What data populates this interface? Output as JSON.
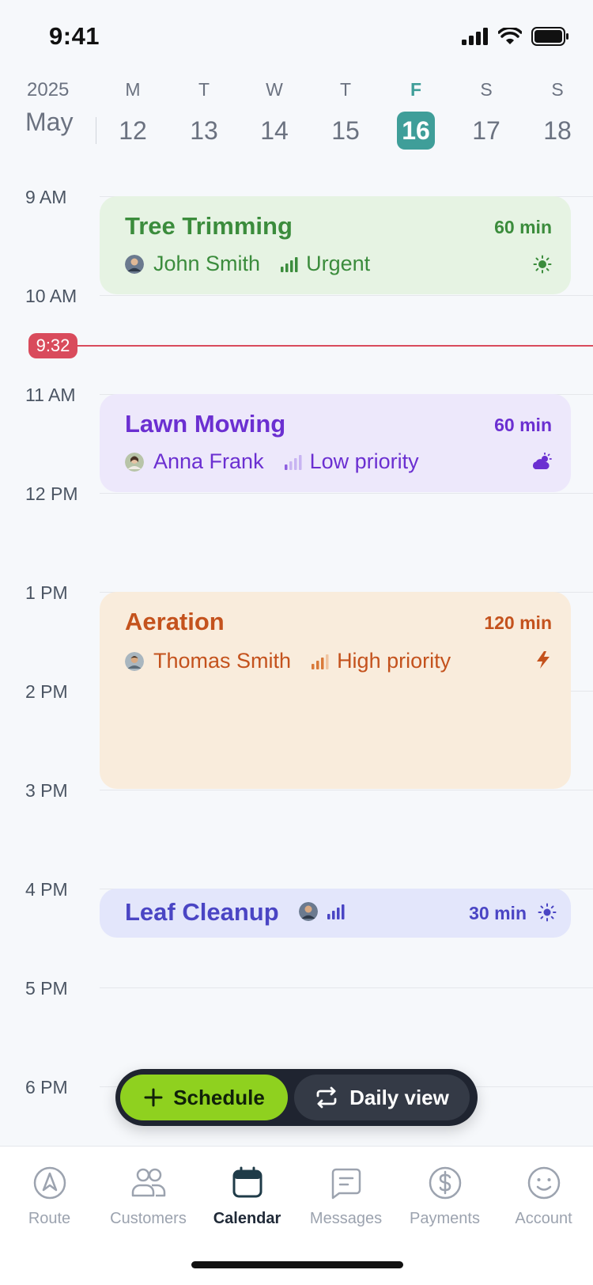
{
  "status": {
    "time": "9:41"
  },
  "week": {
    "year": "2025",
    "month": "May",
    "days": [
      {
        "letter": "M",
        "num": "12"
      },
      {
        "letter": "T",
        "num": "13"
      },
      {
        "letter": "W",
        "num": "14"
      },
      {
        "letter": "T",
        "num": "15"
      },
      {
        "letter": "F",
        "num": "16"
      },
      {
        "letter": "S",
        "num": "17"
      },
      {
        "letter": "S",
        "num": "18"
      }
    ],
    "selected_num": "16"
  },
  "timeline": {
    "hours": [
      "9 AM",
      "10 AM",
      "11 AM",
      "12 PM",
      "1 PM",
      "2 PM",
      "3 PM",
      "4 PM",
      "5 PM",
      "6 PM"
    ],
    "now_label": "9:32"
  },
  "events": [
    {
      "title": "Tree Trimming",
      "duration": "60 min",
      "person": "John Smith",
      "priority": "Urgent",
      "weather_icon": "sun-icon",
      "color": "#3b8c3c"
    },
    {
      "title": "Lawn Mowing",
      "duration": "60 min",
      "person": "Anna Frank",
      "priority": "Low priority",
      "weather_icon": "cloud-sun-icon",
      "color": "#6b2fd1"
    },
    {
      "title": "Aeration",
      "duration": "120 min",
      "person": "Thomas Smith",
      "priority": "High priority",
      "weather_icon": "lightning-icon",
      "color": "#c4521d"
    },
    {
      "title": "Leaf Cleanup",
      "duration": "30 min",
      "weather_icon": "sun-icon",
      "color": "#4a45c4"
    }
  ],
  "actions": {
    "schedule_label": "Schedule",
    "daily_view_label": "Daily view"
  },
  "tabs": [
    {
      "label": "Route",
      "icon": "route-icon"
    },
    {
      "label": "Customers",
      "icon": "customers-icon"
    },
    {
      "label": "Calendar",
      "icon": "calendar-icon"
    },
    {
      "label": "Messages",
      "icon": "messages-icon"
    },
    {
      "label": "Payments",
      "icon": "payments-icon"
    },
    {
      "label": "Account",
      "icon": "account-icon"
    }
  ],
  "active_tab": "Calendar",
  "colors": {
    "accent": "#3f9e99",
    "now": "#d94b5c",
    "schedule": "#8fd11f"
  }
}
